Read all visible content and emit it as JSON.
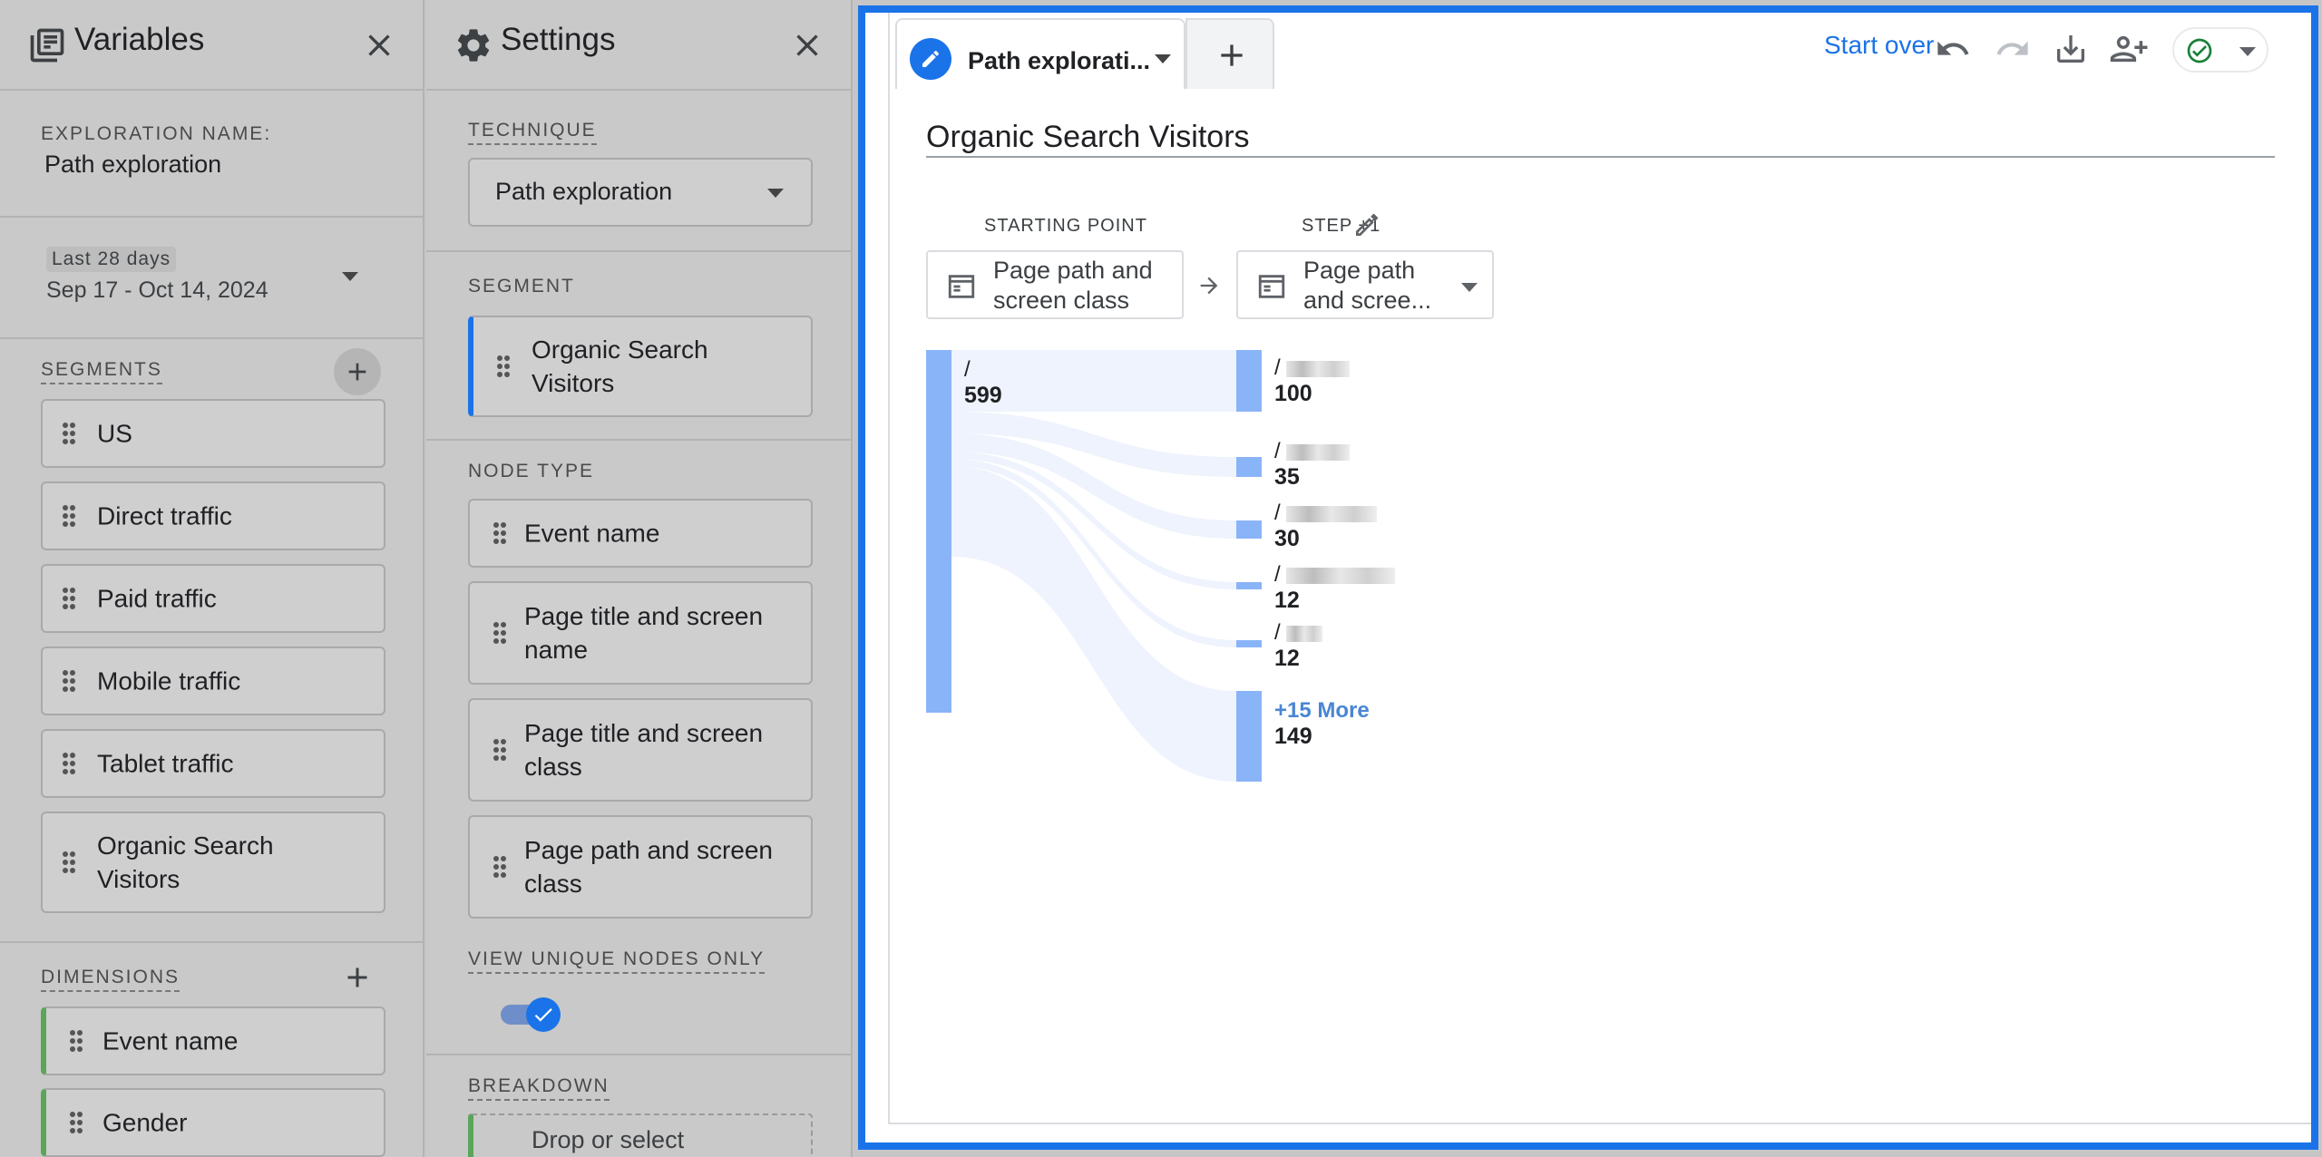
{
  "variables": {
    "title": "Variables",
    "exploration_name_label": "EXPLORATION NAME:",
    "exploration_name": "Path exploration",
    "date_range_label": "Last 28 days",
    "date_range": "Sep 17 - Oct 14, 2024",
    "segments_label": "SEGMENTS",
    "segments": [
      "US",
      "Direct traffic",
      "Paid traffic",
      "Mobile traffic",
      "Tablet traffic",
      "Organic Search Visitors"
    ],
    "dimensions_label": "DIMENSIONS",
    "dimensions": [
      "Event name",
      "Gender"
    ]
  },
  "settings": {
    "title": "Settings",
    "technique_label": "TECHNIQUE",
    "technique": "Path exploration",
    "segment_label": "SEGMENT",
    "segment": "Organic Search Visitors",
    "node_type_label": "NODE TYPE",
    "node_types": [
      "Event name",
      "Page title and screen name",
      "Page title and screen class",
      "Page path and screen class"
    ],
    "unique_nodes_label": "VIEW UNIQUE NODES ONLY",
    "unique_nodes_enabled": true,
    "breakdown_label": "BREAKDOWN",
    "breakdown_placeholder": "Drop or select"
  },
  "canvas": {
    "tab_label": "Path explorati...",
    "toolbar": {
      "start_over": "Start over"
    },
    "viz_title": "Organic Search Visitors",
    "starting_point": {
      "label": "STARTING POINT",
      "selector": "Page path and screen class",
      "node_path": "/",
      "node_count": "599"
    },
    "step1": {
      "label": "STEP +1",
      "selector": "Page path and scree...",
      "nodes": [
        {
          "path": "/",
          "count": "100"
        },
        {
          "path": "/",
          "count": "35"
        },
        {
          "path": "/",
          "count": "30"
        },
        {
          "path": "/",
          "count": "12"
        },
        {
          "path": "/",
          "count": "12"
        }
      ],
      "more_label": "+15 More",
      "more_count": "149"
    }
  },
  "colors": {
    "accent": "#1a73e8",
    "node_bar": "#8ab4f8",
    "flow": "#eef3fd",
    "dimension_accent": "#5aa55a",
    "checkmark": "#188038"
  }
}
